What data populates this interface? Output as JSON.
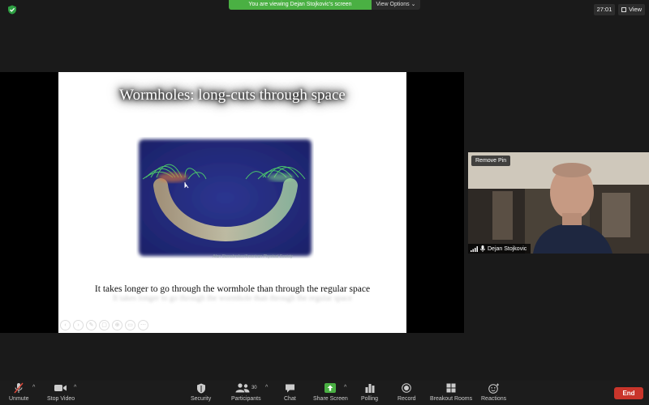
{
  "top_bar": {
    "share_banner": "You are viewing Dejan Stojkovic's screen",
    "view_options": "View Options",
    "timer": "27:01",
    "view_button": "View"
  },
  "slide": {
    "title": "Wormholes: long-cuts through space",
    "image_credit": "Alan Stonebraker/American Physical Society",
    "caption": "It takes longer to go through the wormhole than through the regular space"
  },
  "video": {
    "remove_pin": "Remove Pin",
    "participant_name": "Dejan Stojkovic"
  },
  "toolbar": {
    "unmute": "Unmute",
    "stop_video": "Stop Video",
    "security": "Security",
    "participants": "Participants",
    "participants_count": "30",
    "chat": "Chat",
    "share_screen": "Share Screen",
    "polling": "Polling",
    "record": "Record",
    "breakout_rooms": "Breakout Rooms",
    "reactions": "Reactions",
    "end": "End"
  },
  "colors": {
    "share_banner": "#4ab043",
    "share_screen_icon": "#4ab043",
    "end_button": "#c9352b",
    "unmute_icon": "#e04b3c"
  }
}
